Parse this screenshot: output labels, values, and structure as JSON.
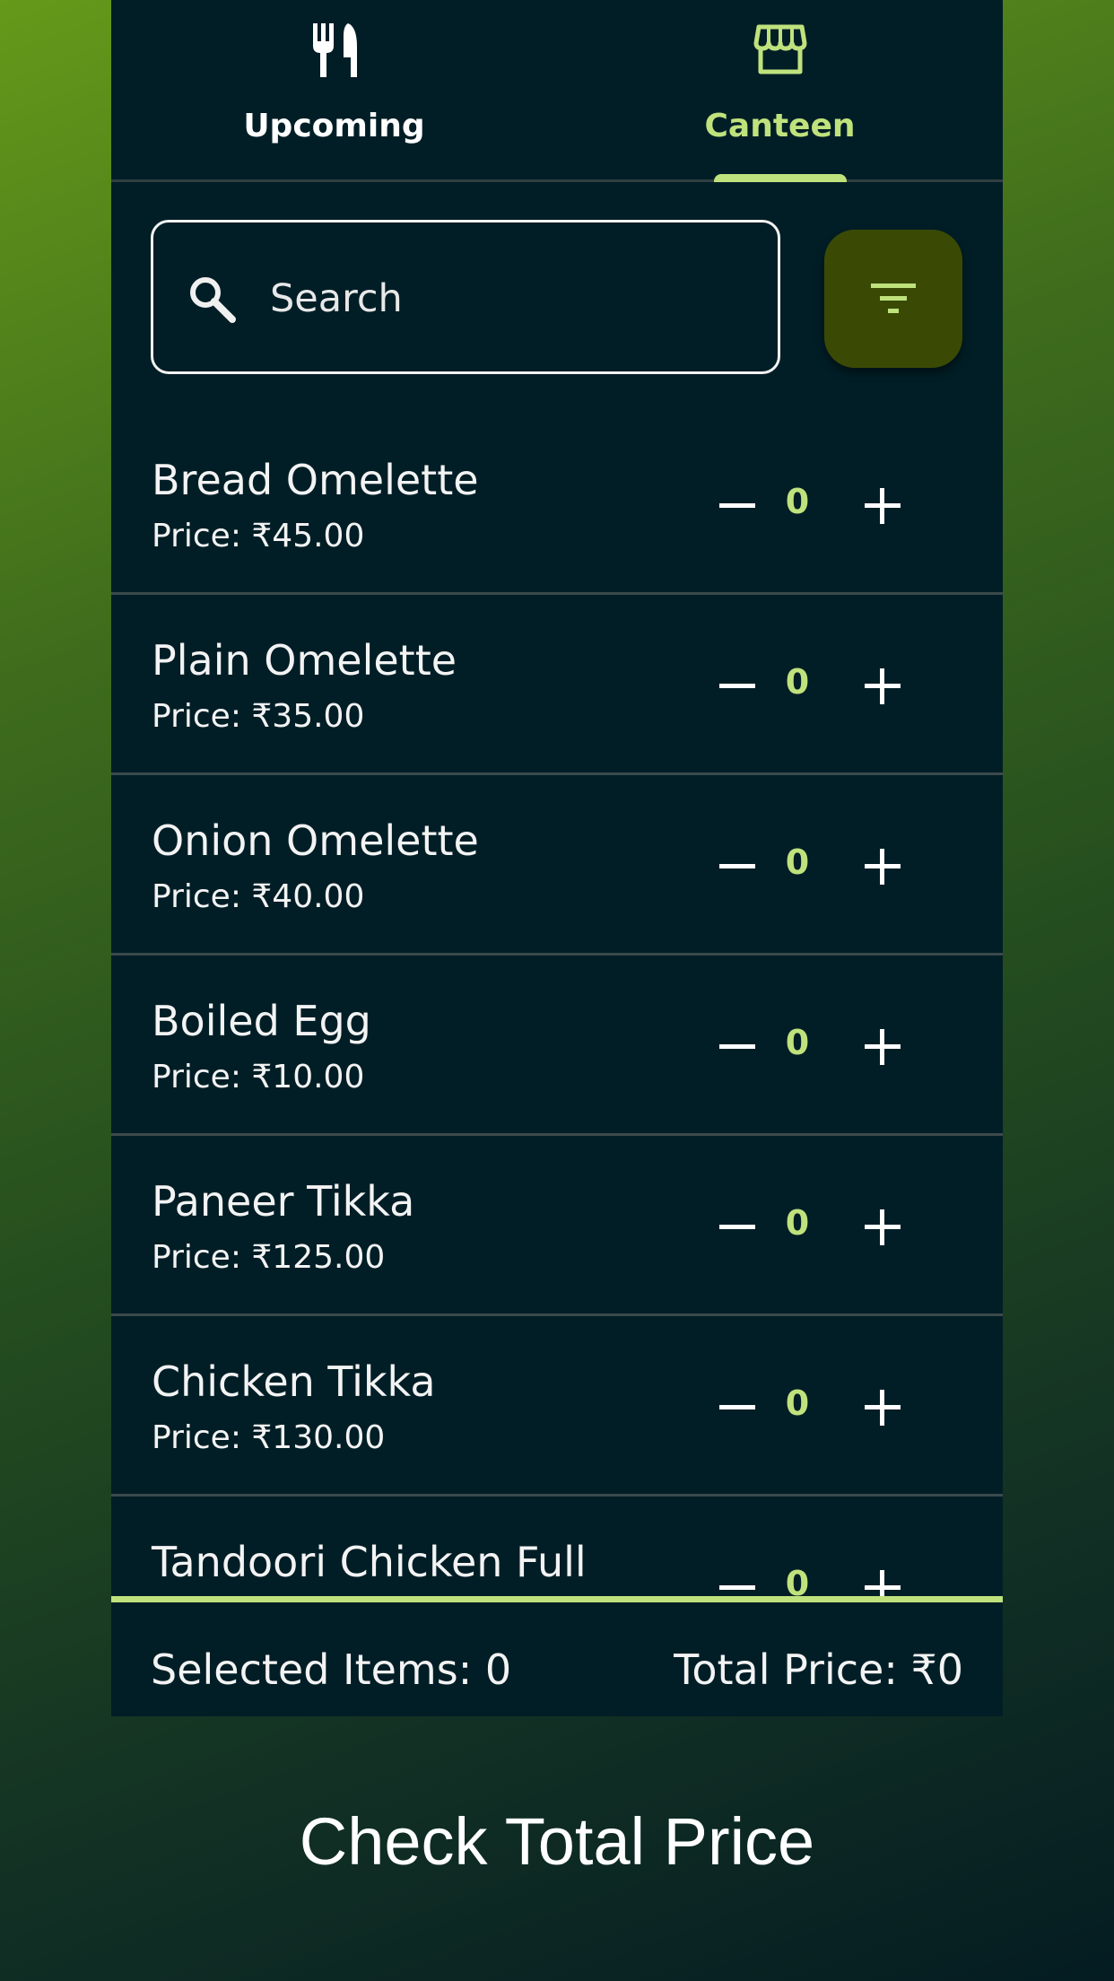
{
  "tabs": [
    {
      "label": "Upcoming",
      "icon": "fork-knife-icon",
      "active": false
    },
    {
      "label": "Canteen",
      "icon": "storefront-icon",
      "active": true
    }
  ],
  "search": {
    "placeholder": "Search"
  },
  "filter": {
    "icon": "filter-icon"
  },
  "items": [
    {
      "name": "Bread Omelette",
      "price": "Price: ₹45.00",
      "qty": "0"
    },
    {
      "name": "Plain Omelette",
      "price": "Price: ₹35.00",
      "qty": "0"
    },
    {
      "name": "Onion Omelette",
      "price": "Price: ₹40.00",
      "qty": "0"
    },
    {
      "name": "Boiled Egg",
      "price": "Price: ₹10.00",
      "qty": "0"
    },
    {
      "name": "Paneer Tikka",
      "price": "Price: ₹125.00",
      "qty": "0"
    },
    {
      "name": "Chicken Tikka",
      "price": "Price: ₹130.00",
      "qty": "0"
    },
    {
      "name": "Tandoori Chicken Full",
      "price": "",
      "qty": "0"
    }
  ],
  "summary": {
    "selected": "Selected Items: 0",
    "total": "Total Price: ₹0"
  },
  "caption": "Check Total Price",
  "colors": {
    "accent": "#bfe27d",
    "panel": "#011e26",
    "filter_bg": "#3a4a05"
  }
}
